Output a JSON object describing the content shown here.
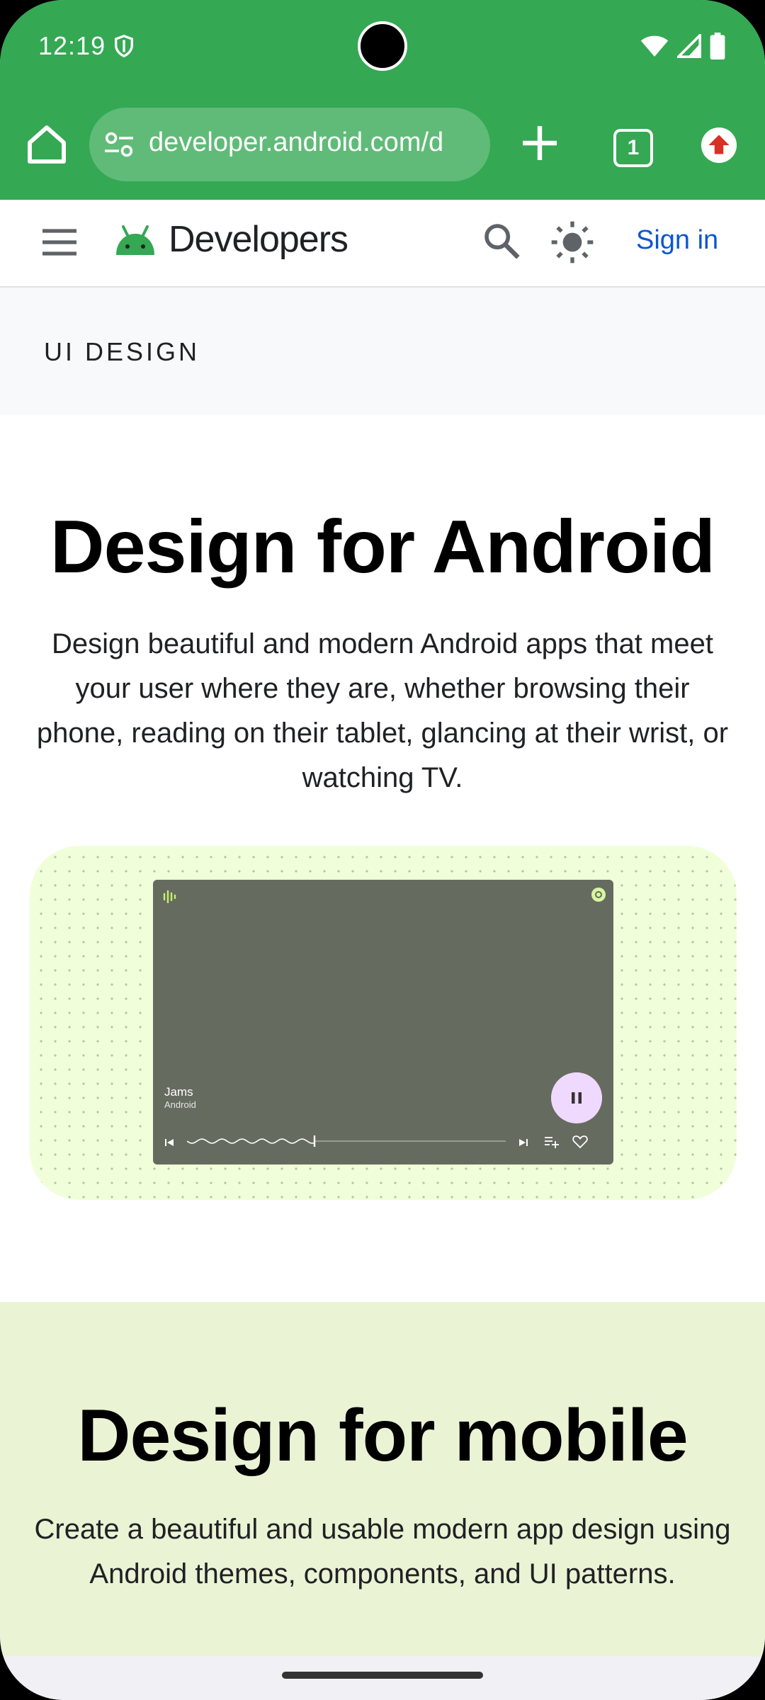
{
  "status": {
    "time": "12:19"
  },
  "browser": {
    "url": "developer.android.com/d",
    "tab_count": "1"
  },
  "site": {
    "brand": "Developers",
    "sign_in": "Sign in"
  },
  "breadcrumb": "UI DESIGN",
  "hero": {
    "title": "Design for Android",
    "text": "Design beautiful and modern Android apps that meet your user where they are, whether browsing their phone, reading on their tablet, glancing at their wrist, or watching TV."
  },
  "player": {
    "title": "Jams",
    "subtitle": "Android",
    "progress": 0.4
  },
  "mobile": {
    "title": "Design for mobile",
    "text": "Create a beautiful and usable modern app design using Android themes, components, and UI patterns."
  },
  "colors": {
    "chrome": "#34a853",
    "link": "#0b57d0",
    "illustration_bg": "#f0ffd9",
    "mobile_band": "#eaf3d4",
    "pause_button": "#f0d9ff"
  },
  "icons": [
    "shield-icon",
    "wifi-icon",
    "signal-icon",
    "battery-icon",
    "home-icon",
    "site-settings-icon",
    "new-tab-icon",
    "tab-switcher-icon",
    "update-icon",
    "menu-icon",
    "android-logo-icon",
    "search-icon",
    "theme-toggle-icon"
  ]
}
